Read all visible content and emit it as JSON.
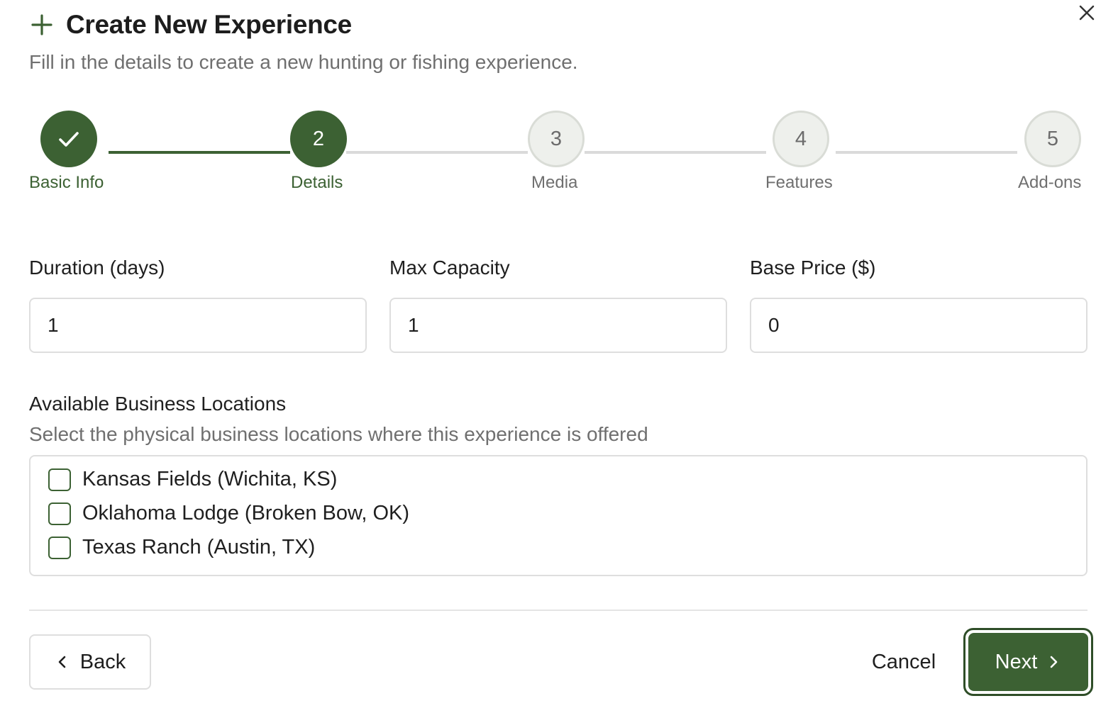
{
  "dialog": {
    "title": "Create New Experience",
    "subtitle": "Fill in the details to create a new hunting or fishing experience."
  },
  "stepper": {
    "steps": [
      {
        "number": "1",
        "label": "Basic Info",
        "state": "completed"
      },
      {
        "number": "2",
        "label": "Details",
        "state": "current"
      },
      {
        "number": "3",
        "label": "Media",
        "state": "pending"
      },
      {
        "number": "4",
        "label": "Features",
        "state": "pending"
      },
      {
        "number": "5",
        "label": "Add-ons",
        "state": "pending"
      }
    ]
  },
  "fields": {
    "duration": {
      "label": "Duration (days)",
      "value": "1"
    },
    "capacity": {
      "label": "Max Capacity",
      "value": "1"
    },
    "price": {
      "label": "Base Price ($)",
      "value": "0"
    }
  },
  "locations": {
    "title": "Available Business Locations",
    "help": "Select the physical business locations where this experience is offered",
    "items": [
      {
        "label": "Kansas Fields (Wichita, KS)",
        "checked": false
      },
      {
        "label": "Oklahoma Lodge (Broken Bow, OK)",
        "checked": false
      },
      {
        "label": "Texas Ranch (Austin, TX)",
        "checked": false
      }
    ]
  },
  "footer": {
    "back_label": "Back",
    "cancel_label": "Cancel",
    "next_label": "Next"
  },
  "icons": {
    "close": "close-icon",
    "plus": "plus-icon",
    "check": "check-icon",
    "back": "chevron-left-icon",
    "next": "chevron-right-icon"
  },
  "colors": {
    "accent": "#3c6133",
    "muted_text": "#6f6f6f",
    "border": "#dedede"
  }
}
